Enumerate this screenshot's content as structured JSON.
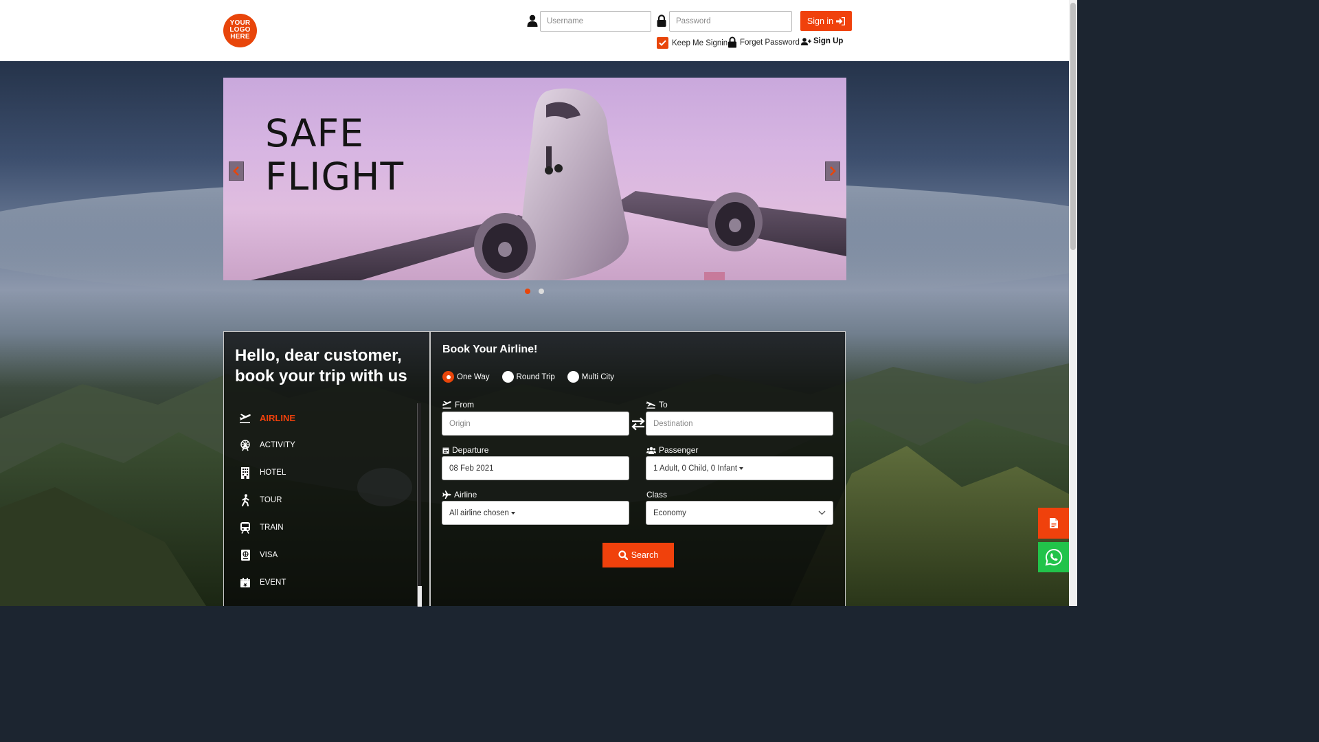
{
  "header": {
    "logo_lines": [
      "YOUR",
      "LOGO",
      "HERE"
    ],
    "username_placeholder": "Username",
    "password_placeholder": "Password",
    "signin_label": "Sign in",
    "keep_me_label": "Keep Me Signin",
    "forget_label": "Forget Password",
    "signup_label": "Sign Up",
    "keep_me_checked": true
  },
  "banner": {
    "title_line1": "SAFE",
    "title_line2": "FLIGHT",
    "slide_count": 2,
    "active_slide": 1
  },
  "left_panel": {
    "greeting": "Hello, dear customer, book your trip with us",
    "menu": [
      {
        "label": "AIRLINE",
        "icon": "plane-takeoff-icon",
        "active": true
      },
      {
        "label": "ACTIVITY",
        "icon": "ferris-wheel-icon",
        "active": false
      },
      {
        "label": "HOTEL",
        "icon": "building-icon",
        "active": false
      },
      {
        "label": "TOUR",
        "icon": "hiker-icon",
        "active": false
      },
      {
        "label": "TRAIN",
        "icon": "train-icon",
        "active": false
      },
      {
        "label": "VISA",
        "icon": "passport-icon",
        "active": false
      },
      {
        "label": "EVENT",
        "icon": "calendar-icon",
        "active": false
      }
    ]
  },
  "form": {
    "title": "Book Your Airline!",
    "trip_types": [
      {
        "label": "One Way",
        "selected": true
      },
      {
        "label": "Round Trip",
        "selected": false
      },
      {
        "label": "Multi City",
        "selected": false
      }
    ],
    "from_label": "From",
    "from_placeholder": "Origin",
    "to_label": "To",
    "to_placeholder": "Destination",
    "departure_label": "Departure",
    "departure_value": "08 Feb 2021",
    "passenger_label": "Passenger",
    "passenger_value": "1 Adult, 0 Child, 0 Infant",
    "airline_label": "Airline",
    "airline_value": "All airline chosen",
    "class_label": "Class",
    "class_value": "Economy",
    "search_label": "Search"
  },
  "colors": {
    "accent": "#f0410c",
    "whatsapp": "#22c34a"
  }
}
